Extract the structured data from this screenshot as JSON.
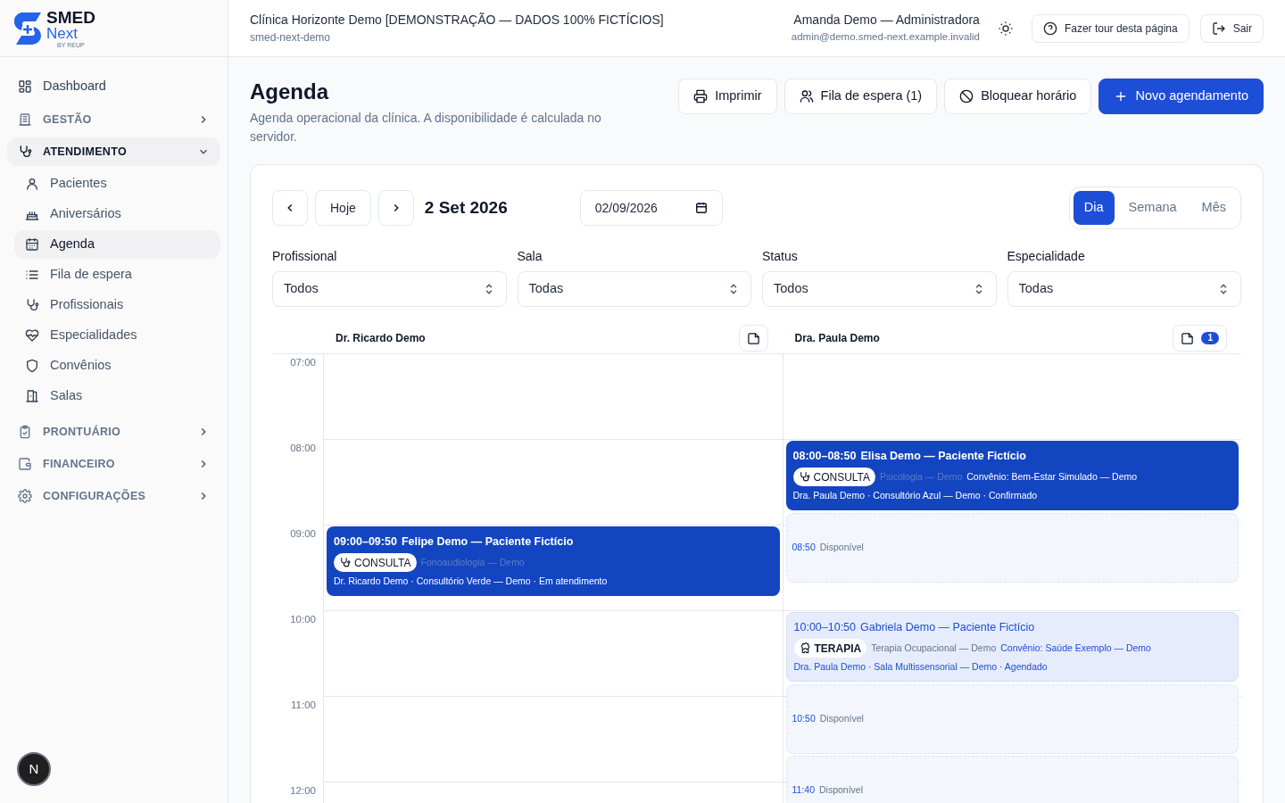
{
  "brand": {
    "name": "SMED",
    "sub": "Next",
    "tagline": "BY REUP"
  },
  "sidebar": {
    "items": [
      {
        "label": "Dashboard",
        "kind": "link",
        "selected": false
      },
      {
        "label": "GESTÃO",
        "kind": "section",
        "expanded": false,
        "selected": false
      },
      {
        "label": "ATENDIMENTO",
        "kind": "section",
        "expanded": true,
        "selected": true,
        "children": [
          {
            "label": "Pacientes",
            "selected": false
          },
          {
            "label": "Aniversários",
            "selected": false
          },
          {
            "label": "Agenda",
            "selected": true
          },
          {
            "label": "Fila de espera",
            "selected": false
          },
          {
            "label": "Profissionais",
            "selected": false
          },
          {
            "label": "Especialidades",
            "selected": false
          },
          {
            "label": "Convênios",
            "selected": false
          },
          {
            "label": "Salas",
            "selected": false
          }
        ]
      },
      {
        "label": "PRONTUÁRIO",
        "kind": "section",
        "expanded": false,
        "selected": false
      },
      {
        "label": "FINANCEIRO",
        "kind": "section",
        "expanded": false,
        "selected": false
      },
      {
        "label": "CONFIGURAÇÕES",
        "kind": "section",
        "expanded": false,
        "selected": false
      }
    ],
    "avatar": "N"
  },
  "header": {
    "clinic": "Clínica Horizonte Demo [DEMONSTRAÇÃO — DADOS 100% FICTÍCIOS]",
    "slug": "smed-next-demo",
    "user": "Amanda Demo — Administradora",
    "email": "admin@demo.smed-next.example.invalid",
    "tour": "Fazer tour desta página",
    "logout": "Sair"
  },
  "page": {
    "title": "Agenda",
    "subtitle": "Agenda operacional da clínica. A disponibilidade é calculada no servidor.",
    "actions": [
      {
        "label": "Imprimir",
        "kind": "outline"
      },
      {
        "label": "Fila de espera (1)",
        "kind": "outline"
      },
      {
        "label": "Bloquear horário",
        "kind": "outline"
      },
      {
        "label": "Novo agendamento",
        "kind": "primary"
      }
    ]
  },
  "toolbar": {
    "today": "Hoje",
    "date_label": "2 Set 2026",
    "date_value": "02/09/2026",
    "views": [
      {
        "label": "Dia",
        "selected": true
      },
      {
        "label": "Semana",
        "selected": false
      },
      {
        "label": "Mês",
        "selected": false
      }
    ]
  },
  "filters": [
    {
      "label": "Profissional",
      "value": "Todos"
    },
    {
      "label": "Sala",
      "value": "Todas"
    },
    {
      "label": "Status",
      "value": "Todos"
    },
    {
      "label": "Especialidade",
      "value": "Todas"
    }
  ],
  "times": [
    "07:00",
    "08:00",
    "09:00",
    "10:00",
    "11:00",
    "12:00"
  ],
  "columns": [
    {
      "name": "Dr. Ricardo Demo",
      "entries": [
        {
          "kind": "solid",
          "time": "09:00–09:50",
          "title": "Felipe Demo — Paciente Fictício",
          "badge": {
            "label": "CONSULTA",
            "kind": "consulta"
          },
          "specialty": "Fonoaudiologia — Demo",
          "detail": "Dr. Ricardo Demo · Consultório Verde — Demo · Em atendimento"
        }
      ]
    },
    {
      "name": "Dra. Paula Demo",
      "count": "1",
      "entries": [
        {
          "kind": "solid",
          "time": "08:00–08:50",
          "title": "Elisa Demo — Paciente Fictício",
          "badge": {
            "label": "CONSULTA",
            "kind": "consulta"
          },
          "specialty": "Psicologia — Demo",
          "insurance": "Convênio: Bem-Estar Simulado — Demo",
          "detail": "Dra. Paula Demo · Consultório Azul — Demo · Confirmado"
        },
        {
          "kind": "free",
          "time": "08:50",
          "title": "Disponível"
        },
        {
          "kind": "soft",
          "time": "10:00–10:50",
          "title": "Gabriela Demo — Paciente Fictício",
          "badge": {
            "label": "TERAPIA",
            "kind": "terapia"
          },
          "specialty": "Terapia Ocupacional — Demo",
          "insurance": "Convênio: Saúde Exemplo — Demo",
          "detail": "Dra. Paula Demo · Sala Multissensorial — Demo · Agendado"
        },
        {
          "kind": "free",
          "time": "10:50",
          "title": "Disponível"
        },
        {
          "kind": "free",
          "time": "11:40",
          "title": "Disponível"
        }
      ]
    }
  ]
}
